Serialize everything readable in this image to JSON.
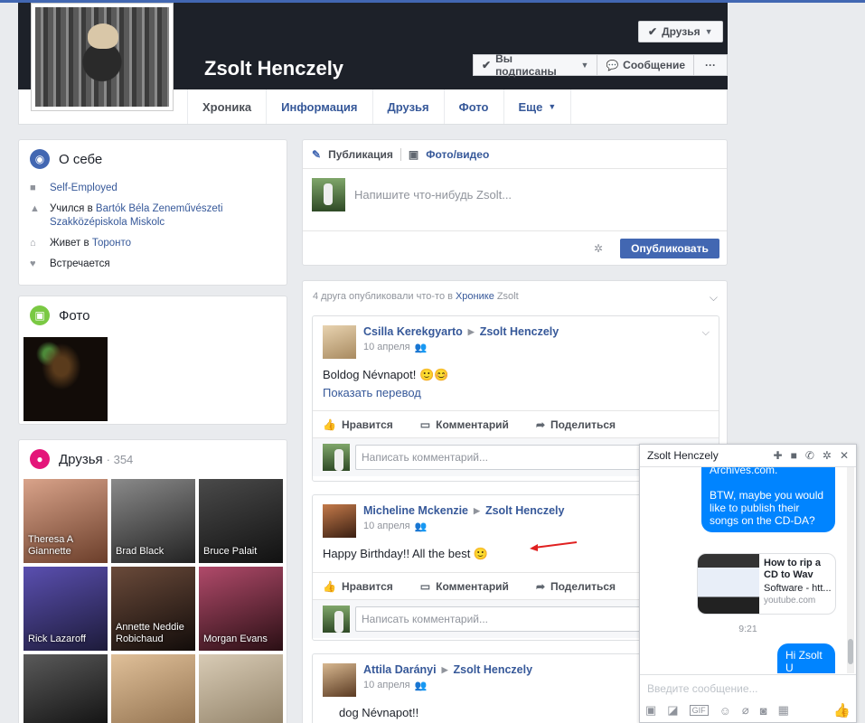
{
  "profile": {
    "name": "Zsolt Henczely",
    "friends_button": "Друзья",
    "following_button": "Вы подписаны",
    "message_button": "Сообщение",
    "more_button": "···"
  },
  "tabs": [
    {
      "label": "Хроника"
    },
    {
      "label": "Информация"
    },
    {
      "label": "Друзья"
    },
    {
      "label": "Фото"
    },
    {
      "label": "Еще"
    }
  ],
  "about": {
    "title": "О себе",
    "work": "Self-Employed",
    "study_prefix": "Учился в",
    "study_link": "Bartók Béla Zeneművészeti Szakközépiskola Miskolc",
    "lives_prefix": "Живет в",
    "lives_link": "Торонто",
    "relationship": "Встречается"
  },
  "photos": {
    "title": "Фото"
  },
  "friends": {
    "title": "Друзья",
    "count": "· 354",
    "items": [
      {
        "name": "Theresa A Giannette",
        "color": "#8a5a3a"
      },
      {
        "name": "Brad Black",
        "color": "#3a3a3a"
      },
      {
        "name": "Bruce Palait",
        "color": "#1f1f1f"
      },
      {
        "name": "Rick Lazaroff",
        "color": "#3b3f7a"
      },
      {
        "name": "Annette Neddie Robichaud",
        "color": "#2b1e1a"
      },
      {
        "name": "Morgan Evans",
        "color": "#5a2a2a"
      },
      {
        "name": "",
        "color": "#151515"
      },
      {
        "name": "",
        "color": "#c9a47a"
      },
      {
        "name": "",
        "color": "#b8a890"
      }
    ]
  },
  "composer": {
    "tab_post": "Публикация",
    "tab_photo": "Фото/видео",
    "placeholder": "Напишите что-нибудь Zsolt...",
    "publish": "Опубликовать"
  },
  "timeline": {
    "header_prefix": "4 друга опубликовали что-то в",
    "header_link": "Хронике",
    "header_suffix": "Zsolt"
  },
  "posts": [
    {
      "author": "Csilla Kerekgyarto",
      "target": "Zsolt Henczely",
      "date": "10 апреля",
      "text": "Boldog Névnapot! 🙂😊",
      "translate": "Показать перевод"
    },
    {
      "author": "Micheline Mckenzie",
      "target": "Zsolt Henczely",
      "date": "10 апреля",
      "text": "Happy Birthday!! All the best 🙂"
    },
    {
      "author": "Attila Darányi",
      "target": "Zsolt Henczely",
      "date": "10 апреля"
    }
  ],
  "post_actions": {
    "like": "Нравится",
    "comment": "Комментарий",
    "share": "Поделиться",
    "comment_placeholder": "Написать комментарий..."
  },
  "bottom_text": "dog Névnapot!!",
  "chat": {
    "title": "Zsolt Henczely",
    "msg_top": "Archives.com.",
    "msg_mid": "BTW, maybe you would like to publish their songs on the CD-DA?",
    "link_title": "How to rip a CD to Wav",
    "link_desc": "Software - htt...",
    "link_source": "youtube.com",
    "time": "9:21",
    "msg_reply": "Hi Zsolt U alright?..",
    "input_placeholder": "Введите сообщение..."
  },
  "colors": {
    "brand": "#4267b2",
    "link": "#365899",
    "messenger_blue": "#0084ff"
  }
}
